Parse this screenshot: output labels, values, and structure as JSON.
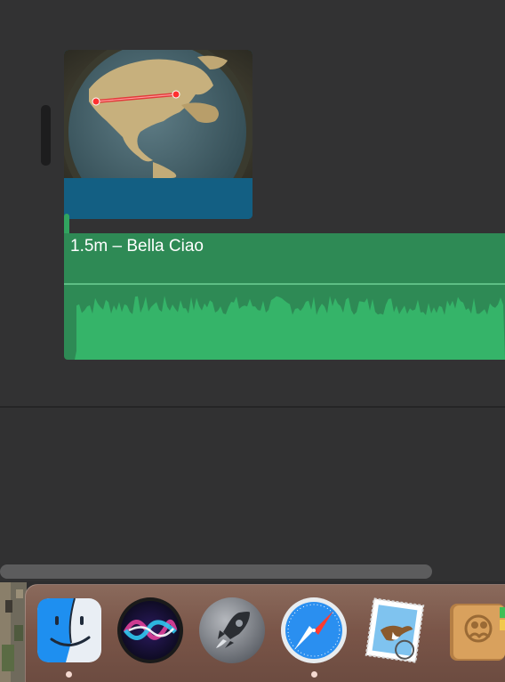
{
  "timeline": {
    "audio_clip": {
      "title": "1.5m – Bella Ciao",
      "color": "#2e8a55"
    },
    "video_clip": {
      "thumbnail": "globe-map-thumbnail",
      "band_color": "#135f83"
    }
  },
  "dock": {
    "items": [
      {
        "name": "finder-icon",
        "running": true
      },
      {
        "name": "siri-icon",
        "running": false
      },
      {
        "name": "launchpad-icon",
        "running": false
      },
      {
        "name": "safari-icon",
        "running": true
      },
      {
        "name": "mail-icon",
        "running": false
      },
      {
        "name": "contacts-icon",
        "running": false
      }
    ]
  }
}
